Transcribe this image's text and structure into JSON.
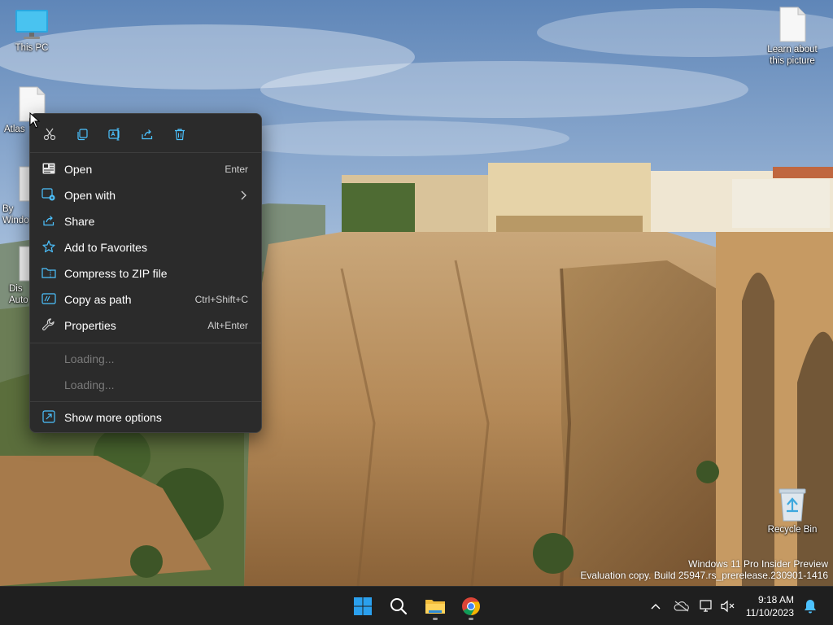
{
  "desktop": {
    "icons": [
      {
        "id": "this-pc",
        "label": "This PC"
      },
      {
        "id": "atlas",
        "label": "Atlas"
      },
      {
        "id": "by",
        "label": "By\nWindo"
      },
      {
        "id": "dis",
        "label": "Dis\nAuto"
      },
      {
        "id": "learn",
        "label": "Learn about\nthis picture"
      },
      {
        "id": "recycle",
        "label": "Recycle Bin"
      }
    ]
  },
  "context_menu": {
    "quick_actions": [
      {
        "name": "cut-icon"
      },
      {
        "name": "copy-icon"
      },
      {
        "name": "rename-icon"
      },
      {
        "name": "share-icon"
      },
      {
        "name": "delete-icon"
      }
    ],
    "items": [
      {
        "label": "Open",
        "shortcut": "Enter",
        "icon": "open-icon"
      },
      {
        "label": "Open with",
        "shortcut": "",
        "icon": "open-with-icon"
      },
      {
        "label": "Share",
        "shortcut": "",
        "icon": "share-icon"
      },
      {
        "label": "Add to Favorites",
        "shortcut": "",
        "icon": "star-icon"
      },
      {
        "label": "Compress to ZIP file",
        "shortcut": "",
        "icon": "zip-icon"
      },
      {
        "label": "Copy as path",
        "shortcut": "Ctrl+Shift+C",
        "icon": "copy-path-icon"
      },
      {
        "label": "Properties",
        "shortcut": "Alt+Enter",
        "icon": "wrench-icon"
      }
    ],
    "loading": [
      "Loading...",
      "Loading..."
    ],
    "more": {
      "label": "Show more options",
      "icon": "show-more-icon"
    }
  },
  "watermark": {
    "line1": "Windows 11 Pro Insider Preview",
    "line2": "Evaluation copy. Build 25947.rs_prerelease.230901-1416"
  },
  "taskbar": {
    "apps": [
      "start-icon",
      "search-icon",
      "file-explorer-icon",
      "chrome-icon"
    ],
    "clock": {
      "time": "9:18 AM",
      "date": "11/10/2023"
    }
  },
  "colors": {
    "accent": "#4cc2ff",
    "menu_bg": "#2b2b2b",
    "taskbar_bg": "#1f1f1f"
  }
}
